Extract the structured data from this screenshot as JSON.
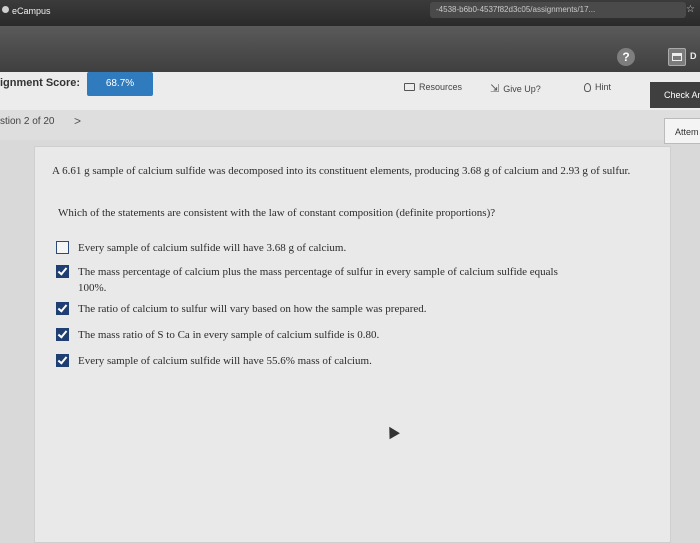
{
  "browser": {
    "tab_title": "eCampus",
    "url_fragment": "-4538-b6b0-4537f82d3c05/assignments/17..."
  },
  "header": {
    "help_label": "?",
    "d_label": "D"
  },
  "score": {
    "label": "ignment Score:",
    "value": "68.7%"
  },
  "toolbar": {
    "resources": "Resources",
    "give_up": "Give Up?",
    "hint": "Hint",
    "check_answer": "Check An"
  },
  "nav": {
    "question_count": "stion 2 of 20",
    "next_arrow": ">",
    "attempt": "Attem"
  },
  "question": {
    "problem": "A 6.61 g sample of calcium sulfide was decomposed into its constituent elements, producing 3.68 g of calcium and 2.93 g of sulfur.",
    "prompt": "Which of the statements are consistent with the law of constant composition (definite proportions)?",
    "options": [
      {
        "text": "Every sample of calcium sulfide will have 3.68 g of calcium.",
        "checked": false
      },
      {
        "text": "The mass percentage of calcium plus the mass percentage of sulfur in every sample of calcium sulfide equals 100%.",
        "checked": true
      },
      {
        "text": "The ratio of calcium to sulfur will vary based on how the sample was prepared.",
        "checked": true
      },
      {
        "text": "The mass ratio of S to Ca in every sample of calcium sulfide is 0.80.",
        "checked": true
      },
      {
        "text": "Every sample of calcium sulfide will have 55.6% mass of calcium.",
        "checked": true
      }
    ]
  },
  "colors": {
    "score_box": "#2f7bbd",
    "checkbox_checked": "#1f3f72"
  }
}
